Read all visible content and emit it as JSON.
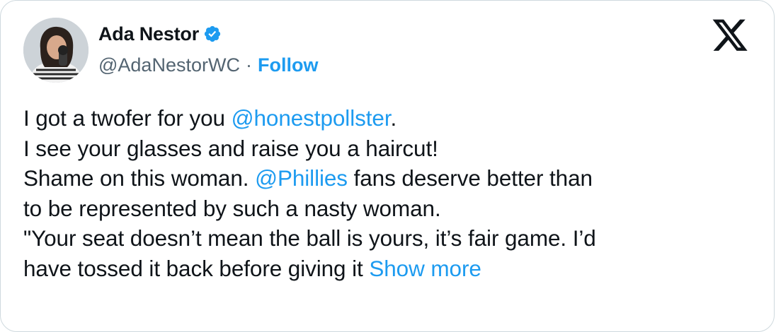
{
  "tweet": {
    "author": {
      "display_name": "Ada Nestor",
      "handle": "@AdaNestorWC",
      "verified_icon": "verified-badge-icon",
      "follow_label": "Follow",
      "separator": "·"
    },
    "brand_icon": "x-logo-icon",
    "lines": [
      {
        "before": "I got a twofer for you ",
        "mention": "@honestpollster",
        "after": "."
      },
      {
        "text": "I see your glasses and raise you a haircut!"
      },
      {
        "before": "Shame on this woman. ",
        "mention": "@Phillies",
        "after": " fans deserve better than"
      },
      {
        "text": "to be represented by such a nasty woman."
      },
      {
        "text": "\"Your seat doesn’t mean the ball is yours, it’s fair game. I’d"
      },
      {
        "before": "have tossed it back before giving it ",
        "show_more": "Show more"
      }
    ]
  },
  "colors": {
    "link": "#1d9bf0",
    "text": "#0f1419",
    "secondary": "#536471",
    "border": "#cfd9de"
  }
}
